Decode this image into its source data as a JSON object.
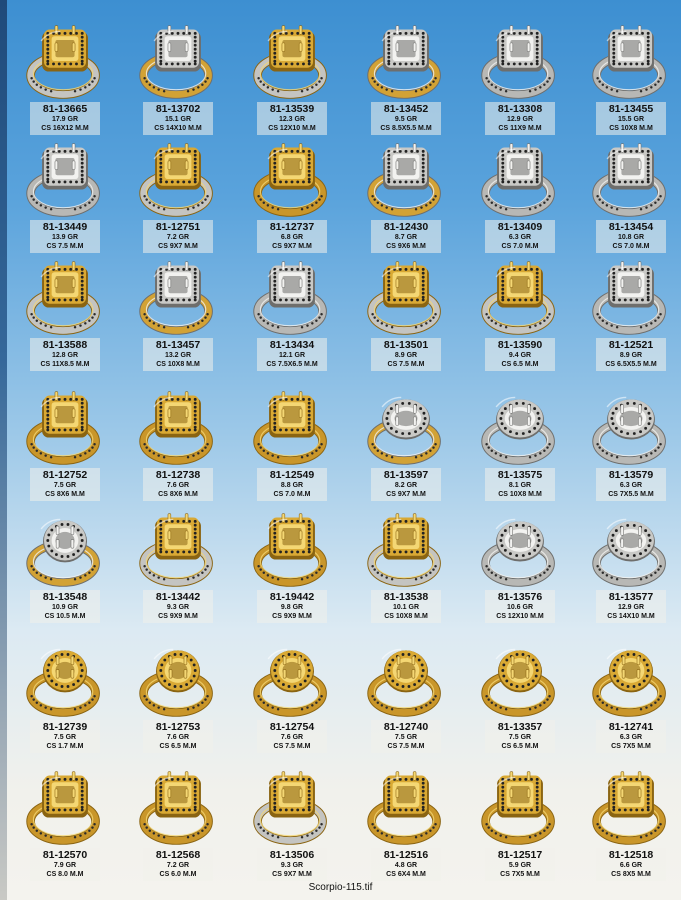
{
  "footer": {
    "filename": "Scorpio-115.tif"
  },
  "rows": [
    {
      "items": [
        {
          "code": "81-13665",
          "weight": "17.9 GR",
          "cs": "CS 16X12 M.M",
          "metal": "yellow-white",
          "shape": "square"
        },
        {
          "code": "81-13702",
          "weight": "15.1 GR",
          "cs": "CS 14X10 M.M",
          "metal": "white-yellow",
          "shape": "square"
        },
        {
          "code": "81-13539",
          "weight": "12.3 GR",
          "cs": "CS 12X10 M.M",
          "metal": "yellow-white",
          "shape": "square"
        },
        {
          "code": "81-13452",
          "weight": "9.5 GR",
          "cs": "CS 8.5X5.5 M.M",
          "metal": "white-yellow",
          "shape": "square"
        },
        {
          "code": "81-13308",
          "weight": "12.9 GR",
          "cs": "CS 11X9 M.M",
          "metal": "white",
          "shape": "square"
        },
        {
          "code": "81-13455",
          "weight": "15.5 GR",
          "cs": "CS 10X8 M.M",
          "metal": "white",
          "shape": "square"
        }
      ]
    },
    {
      "items": [
        {
          "code": "81-13449",
          "weight": "13.9 GR",
          "cs": "CS 7.5 M.M",
          "metal": "white",
          "shape": "square"
        },
        {
          "code": "81-12751",
          "weight": "7.2 GR",
          "cs": "CS 9X7 M.M",
          "metal": "yellow-white",
          "shape": "square"
        },
        {
          "code": "81-12737",
          "weight": "6.8 GR",
          "cs": "CS 9X7 M.M",
          "metal": "yellow",
          "shape": "square"
        },
        {
          "code": "81-12430",
          "weight": "8.7 GR",
          "cs": "CS 9X6 M.M",
          "metal": "white-yellow",
          "shape": "square"
        },
        {
          "code": "81-13409",
          "weight": "6.3 GR",
          "cs": "CS 7.0 M.M",
          "metal": "white",
          "shape": "square"
        },
        {
          "code": "81-13454",
          "weight": "10.8 GR",
          "cs": "CS 7.0 M.M",
          "metal": "white",
          "shape": "square"
        }
      ]
    },
    {
      "items": [
        {
          "code": "81-13588",
          "weight": "12.8 GR",
          "cs": "CS 11X8.5 M.M",
          "metal": "yellow-white",
          "shape": "square"
        },
        {
          "code": "81-13457",
          "weight": "13.2 GR",
          "cs": "CS 10X8 M.M",
          "metal": "white-yellow",
          "shape": "square"
        },
        {
          "code": "81-13434",
          "weight": "12.1 GR",
          "cs": "CS 7.5X6.5 M.M",
          "metal": "white",
          "shape": "square"
        },
        {
          "code": "81-13501",
          "weight": "8.9 GR",
          "cs": "CS 7.5 M.M",
          "metal": "yellow-white",
          "shape": "square"
        },
        {
          "code": "81-13590",
          "weight": "9.4 GR",
          "cs": "CS 6.5 M.M",
          "metal": "yellow-white",
          "shape": "square"
        },
        {
          "code": "81-12521",
          "weight": "8.9 GR",
          "cs": "CS 6.5X5.5 M.M",
          "metal": "white",
          "shape": "square"
        }
      ]
    },
    {
      "items": [
        {
          "code": "81-12752",
          "weight": "7.5 GR",
          "cs": "CS 8X6 M.M",
          "metal": "yellow",
          "shape": "square"
        },
        {
          "code": "81-12738",
          "weight": "7.6 GR",
          "cs": "CS 8X6 M.M",
          "metal": "yellow",
          "shape": "square"
        },
        {
          "code": "81-12549",
          "weight": "8.8 GR",
          "cs": "CS 7.0 M.M",
          "metal": "yellow",
          "shape": "square"
        },
        {
          "code": "81-13597",
          "weight": "8.2 GR",
          "cs": "CS 9X7 M.M",
          "metal": "white-yellow",
          "shape": "oval"
        },
        {
          "code": "81-13575",
          "weight": "8.1 GR",
          "cs": "CS 10X8 M.M",
          "metal": "white",
          "shape": "oval"
        },
        {
          "code": "81-13579",
          "weight": "6.3 GR",
          "cs": "CS 7X5.5 M.M",
          "metal": "white",
          "shape": "oval"
        }
      ]
    },
    {
      "items": [
        {
          "code": "81-13548",
          "weight": "10.9 GR",
          "cs": "CS 10.5 M.M",
          "metal": "white-yellow",
          "shape": "round"
        },
        {
          "code": "81-13442",
          "weight": "9.3 GR",
          "cs": "CS 9X9 M.M",
          "metal": "yellow-white",
          "shape": "square"
        },
        {
          "code": "81-19442",
          "weight": "9.8 GR",
          "cs": "CS 9X9 M.M",
          "metal": "yellow",
          "shape": "square"
        },
        {
          "code": "81-13538",
          "weight": "10.1 GR",
          "cs": "CS 10X8 M.M",
          "metal": "yellow-white",
          "shape": "square"
        },
        {
          "code": "81-13576",
          "weight": "10.6 GR",
          "cs": "CS 12X10 M.M",
          "metal": "white",
          "shape": "oval"
        },
        {
          "code": "81-13577",
          "weight": "12.9 GR",
          "cs": "CS 14X10 M.M",
          "metal": "white",
          "shape": "oval"
        }
      ]
    },
    {
      "items": [
        {
          "code": "81-12739",
          "weight": "7.5 GR",
          "cs": "CS 1.7 M.M",
          "metal": "yellow",
          "shape": "round"
        },
        {
          "code": "81-12753",
          "weight": "7.6 GR",
          "cs": "CS 6.5 M.M",
          "metal": "yellow",
          "shape": "round"
        },
        {
          "code": "81-12754",
          "weight": "7.6 GR",
          "cs": "CS 7.5 M.M",
          "metal": "yellow",
          "shape": "round"
        },
        {
          "code": "81-12740",
          "weight": "7.5 GR",
          "cs": "CS 7.5 M.M",
          "metal": "yellow",
          "shape": "round"
        },
        {
          "code": "81-13357",
          "weight": "7.5 GR",
          "cs": "CS 6.5 M.M",
          "metal": "yellow",
          "shape": "round"
        },
        {
          "code": "81-12741",
          "weight": "6.3 GR",
          "cs": "CS 7X5 M.M",
          "metal": "yellow",
          "shape": "round"
        }
      ]
    },
    {
      "items": [
        {
          "code": "81-12570",
          "weight": "7.9 GR",
          "cs": "CS 8.0 M.M",
          "metal": "yellow",
          "shape": "square"
        },
        {
          "code": "81-12568",
          "weight": "7.2 GR",
          "cs": "CS 6.0 M.M",
          "metal": "yellow",
          "shape": "square"
        },
        {
          "code": "81-13506",
          "weight": "9.3 GR",
          "cs": "CS 9X7 M.M",
          "metal": "yellow-white",
          "shape": "square"
        },
        {
          "code": "81-12516",
          "weight": "4.8 GR",
          "cs": "CS 6X4 M.M",
          "metal": "yellow",
          "shape": "square"
        },
        {
          "code": "81-12517",
          "weight": "5.9 GR",
          "cs": "CS 7X5 M.M",
          "metal": "yellow",
          "shape": "square"
        },
        {
          "code": "81-12518",
          "weight": "6.6 GR",
          "cs": "CS 8X5 M.M",
          "metal": "yellow",
          "shape": "square"
        }
      ]
    }
  ]
}
